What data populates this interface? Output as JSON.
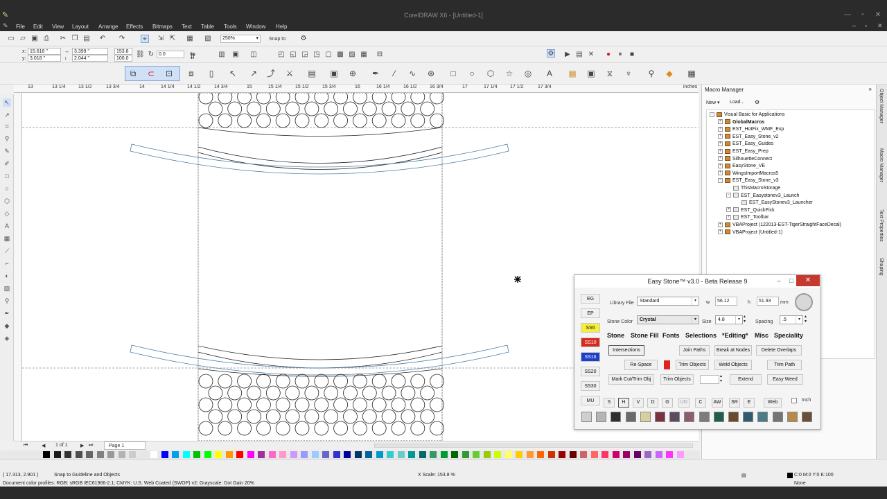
{
  "window": {
    "title": "CorelDRAW X6 - [Untitled-1]"
  },
  "menu": [
    "File",
    "Edit",
    "View",
    "Layout",
    "Arrange",
    "Effects",
    "Bitmaps",
    "Text",
    "Table",
    "Tools",
    "Window",
    "Help"
  ],
  "standard_toolbar": {
    "zoom": "250%",
    "snap_label": "Snap to"
  },
  "property_bar": {
    "x": "15.618 \"",
    "y": "3.018 \"",
    "width": "3.399 \"",
    "height": "2.044 \"",
    "scale_x": "153.8",
    "scale_y": "100.0",
    "rotation": "0.0"
  },
  "ruler": {
    "h_ticks": [
      "13",
      "13 1/4",
      "13 1/2",
      "13 3/4",
      "14",
      "14 1/4",
      "14 1/2",
      "14 3/4",
      "15",
      "15 1/4",
      "15 1/2",
      "15 3/4",
      "16",
      "16 1/4",
      "16 1/2",
      "16 3/4",
      "17",
      "17 1/4",
      "17 1/2",
      "17 3/4",
      "inches"
    ]
  },
  "page_nav": {
    "count": "1 of 1",
    "page_tab": "Page 1"
  },
  "status": {
    "cursor": "( 17.313, 2.901 )",
    "snap": "Snap to Guideline and Objects",
    "profile": "Document color profiles: RGB: sRGB IEC61966-2.1; CMYK: U.S. Web Coated (SWOP) v2; Grayscale: Dot Gain 20%",
    "info": "X Scale: 153.8 %",
    "fill": "C:0 M:0 Y:0 K:100",
    "outline": "None"
  },
  "macro_manager": {
    "title": "Macro Manager",
    "new_label": "New",
    "load_label": "Load...",
    "tree": [
      {
        "label": "Visual Basic for Applications",
        "level": 0,
        "kind": "proj",
        "exp": "-",
        "bold": false
      },
      {
        "label": "GlobalMacros",
        "level": 1,
        "kind": "proj",
        "exp": "+",
        "bold": true
      },
      {
        "label": "EST_HotFix_WMF_Exp",
        "level": 1,
        "kind": "proj",
        "exp": "+",
        "bold": false
      },
      {
        "label": "EST_Easy_Stone_v2",
        "level": 1,
        "kind": "proj",
        "exp": "+",
        "bold": false
      },
      {
        "label": "EST_Easy_Guides",
        "level": 1,
        "kind": "proj",
        "exp": "+",
        "bold": false
      },
      {
        "label": "EST_Easy_Prep",
        "level": 1,
        "kind": "proj",
        "exp": "+",
        "bold": false
      },
      {
        "label": "SilhouetteConnect",
        "level": 1,
        "kind": "proj",
        "exp": "+",
        "bold": false
      },
      {
        "label": "EasyStone_VE",
        "level": 1,
        "kind": "proj",
        "exp": "+",
        "bold": false
      },
      {
        "label": "WingsImportMacros5",
        "level": 1,
        "kind": "proj",
        "exp": "+",
        "bold": false
      },
      {
        "label": "EST_Easy_Stone_v3",
        "level": 1,
        "kind": "proj",
        "exp": "-",
        "bold": false
      },
      {
        "label": "ThisMacroStorage",
        "level": 2,
        "kind": "mod",
        "exp": "",
        "bold": false
      },
      {
        "label": "EST_Easystonev3_Launch",
        "level": 2,
        "kind": "mod",
        "exp": "-",
        "bold": false
      },
      {
        "label": "EST_EasyStonev3_Launcher",
        "level": 3,
        "kind": "mod",
        "exp": "",
        "bold": false
      },
      {
        "label": "EST_QuickPick",
        "level": 2,
        "kind": "mod",
        "exp": "+",
        "bold": false
      },
      {
        "label": "EST_Toolbar",
        "level": 2,
        "kind": "mod",
        "exp": "+",
        "bold": false
      },
      {
        "label": "VBAProject (122013-EST-TigerStraightFaceDecal)",
        "level": 1,
        "kind": "proj",
        "exp": "+",
        "bold": false
      },
      {
        "label": "VBAProject (Untitled-1)",
        "level": 1,
        "kind": "proj",
        "exp": "+",
        "bold": false
      }
    ]
  },
  "side_tabs": [
    "Object Manager",
    "Macro Manager",
    "Text Properties",
    "Shaping"
  ],
  "easy_stone": {
    "title": "Easy Stone™ v3.0 - Beta Release 9",
    "library_label": "Library File",
    "library_value": "Standard",
    "w_label": "w",
    "w_value": "56.12",
    "h_label": "h",
    "h_value": "51.93",
    "unit": "mm",
    "color_label": "Stone Color",
    "color_value": "Crystal",
    "size_label": "Size",
    "size_value": "4.8",
    "spacing_label": "Spacing",
    "spacing_value": ".5",
    "side_buttons": [
      {
        "label": "EG",
        "bg": "#f0f0f0",
        "fg": "#111111"
      },
      {
        "label": "EP",
        "bg": "#f0f0f0",
        "fg": "#111111"
      },
      {
        "label": "SS6",
        "bg": "#f6ee3c",
        "fg": "#111111"
      },
      {
        "label": "SS10",
        "bg": "#d42a1f",
        "fg": "#ffffff"
      },
      {
        "label": "SS16",
        "bg": "#1c3fc7",
        "fg": "#ffffff"
      },
      {
        "label": "SS20",
        "bg": "#f0f0f0",
        "fg": "#111111"
      },
      {
        "label": "SS30",
        "bg": "#f0f0f0",
        "fg": "#111111"
      },
      {
        "label": "MU",
        "bg": "#f0f0f0",
        "fg": "#111111"
      }
    ],
    "tabs": [
      "Stone",
      "Stone Fill",
      "Fonts",
      "Selections",
      "*Editing*",
      "Misc",
      "Speciality"
    ],
    "buttons": {
      "intersections": "Intersections",
      "join_paths": "Join Paths",
      "break_nodes": "Break at Nodes",
      "delete_overlaps": "Delete Overlaps",
      "re_space": "Re-Space",
      "trim_objects_1": "Trim Objects",
      "weld_objects": "Weld Objects",
      "trim_path": "Trim Path",
      "mark_cut": "Mark Cut/Trim Obj",
      "trim_objects_2": "Trim Objects",
      "extend": "Extend",
      "easy_weed": "Easy Weed",
      "web": "Web"
    },
    "toggles": [
      "S",
      "H",
      "V",
      "D",
      "G",
      "UG",
      "C",
      "AW",
      "SR",
      "E"
    ],
    "inch_label": "Inch",
    "accent_red": "#e0231b",
    "swatches": [
      "#cfcfcf",
      "#b5b5b5",
      "#2e2e2e",
      "#6a6a6a",
      "#d8cf9a",
      "#7a3140",
      "#5a4b5e",
      "#8a5d73",
      "#7c7c7c",
      "#1f5d4c",
      "#6b4a2c",
      "#2f5a70",
      "#4b7c8a",
      "#747474",
      "#b88a4a",
      "#6a4e36"
    ]
  }
}
